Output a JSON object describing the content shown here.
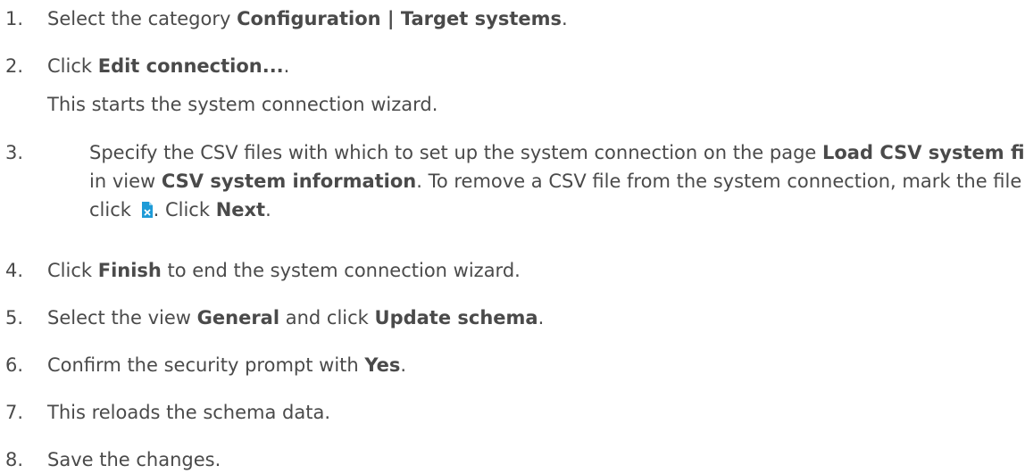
{
  "steps": [
    {
      "num": "1.",
      "before": "Select the category ",
      "bold": "Configuration | Target systems",
      "after": "."
    },
    {
      "num": "2.",
      "before": "Click ",
      "bold": "Edit connection...",
      "after": ".",
      "note": "This starts the system connection wizard."
    },
    {
      "num": "3.",
      "before": "Specify the CSV files with which to set up the system connection on the page ",
      "bold1": "Load CSV system file",
      "mid1": ", in view ",
      "bold2": "CSV system information",
      "mid2": ". To remove a CSV file from the system connection, mark the file and click ",
      "icon": "delete-file-icon",
      "mid3": ". Click ",
      "bold3": "Next",
      "after": "."
    },
    {
      "num": "4.",
      "before": "Click ",
      "bold": "Finish",
      "after": " to end the system connection wizard."
    },
    {
      "num": "5.",
      "before": "Select the view ",
      "bold1": "General",
      "mid1": " and click ",
      "bold2": "Update schema",
      "after": "."
    },
    {
      "num": "6.",
      "before": "Confirm the security prompt with ",
      "bold": "Yes",
      "after": "."
    },
    {
      "num": "7.",
      "text": "This reloads the schema data."
    },
    {
      "num": "8.",
      "text": "Save the changes."
    }
  ],
  "colors": {
    "text": "#4a4a4a",
    "icon_accent": "#1e9bd7"
  }
}
